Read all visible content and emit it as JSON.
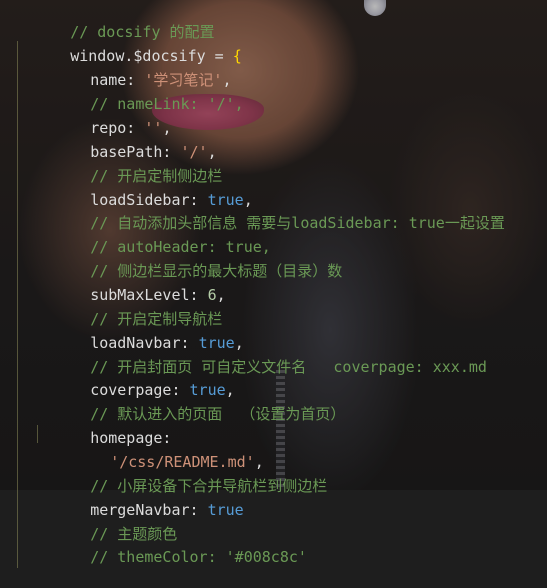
{
  "colors": {
    "background": "#1e1e1e",
    "comment": "#6a9955",
    "string": "#ce9178",
    "boolean": "#569cd6",
    "number": "#b5cea8",
    "brace": "#ffd700",
    "text": "#dcdcdc"
  },
  "code": {
    "line_1": "// docsify 的配置",
    "line_2": {
      "prefix": "window.$docsify = ",
      "brace": "{"
    },
    "line_3": {
      "key": "name: ",
      "value": "'学习笔记'",
      "end": ","
    },
    "line_4": "// nameLink: '/',",
    "line_5": {
      "key": "repo: ",
      "value": "''",
      "end": ","
    },
    "line_6": {
      "key": "basePath: ",
      "value": "'/'",
      "end": ","
    },
    "line_7": "// 开启定制侧边栏",
    "line_8": {
      "key": "loadSidebar: ",
      "value": "true",
      "end": ","
    },
    "line_9": "// 自动添加头部信息 需要与loadSidebar: true一起设置",
    "line_10": "// autoHeader: true,",
    "line_11": "// 侧边栏显示的最大标题（目录）数",
    "line_12": {
      "key": "subMaxLevel: ",
      "value": "6",
      "end": ","
    },
    "line_13": "// 开启定制导航栏",
    "line_14": {
      "key": "loadNavbar: ",
      "value": "true",
      "end": ","
    },
    "line_15": "// 开启封面页 可自定义文件名   coverpage: xxx.md",
    "line_16": {
      "key": "coverpage: ",
      "value": "true",
      "end": ","
    },
    "line_17": "// 默认进入的页面  （设置为首页）",
    "line_18": {
      "key": "homepage:"
    },
    "line_19": {
      "value": "'/css/README.md'",
      "end": ","
    },
    "line_20": "// 小屏设备下合并导航栏到侧边栏",
    "line_21": {
      "key": "mergeNavbar: ",
      "value": "true"
    },
    "line_22": "// 主题颜色",
    "line_23": "// themeColor: '#008c8c'",
    "line_24": {
      "brace": "}"
    }
  }
}
